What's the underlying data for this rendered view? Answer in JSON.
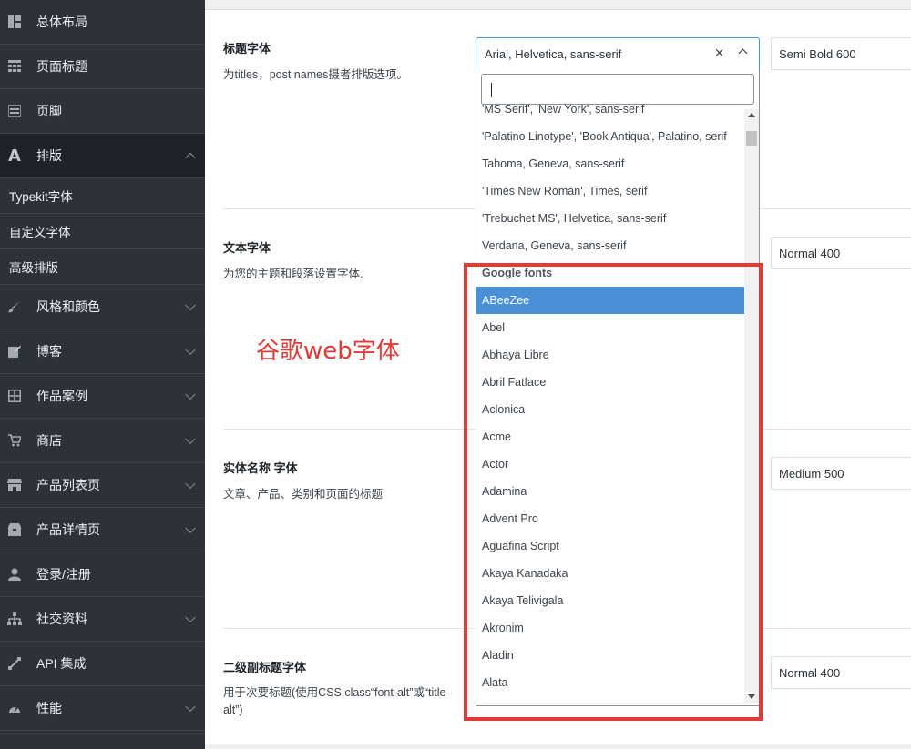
{
  "sidebar": {
    "items": [
      {
        "label": "总体布局",
        "icon": "layout-icon"
      },
      {
        "label": "页面标题",
        "icon": "table-icon"
      },
      {
        "label": "页脚",
        "icon": "footer-icon"
      },
      {
        "label": "排版",
        "icon": "typography-icon",
        "icon_glyph": "A"
      },
      {
        "label": "风格和颜色",
        "icon": "brush-icon"
      },
      {
        "label": "博客",
        "icon": "edit-icon"
      },
      {
        "label": "作品案例",
        "icon": "grid-icon"
      },
      {
        "label": "商店",
        "icon": "cart-icon"
      },
      {
        "label": "产品列表页",
        "icon": "store-icon"
      },
      {
        "label": "产品详情页",
        "icon": "archive-icon"
      },
      {
        "label": "登录/注册",
        "icon": "user-icon"
      },
      {
        "label": "社交资料",
        "icon": "network-icon"
      },
      {
        "label": "API 集成",
        "icon": "plugin-icon"
      },
      {
        "label": "性能",
        "icon": "dashboard-icon"
      }
    ],
    "subitems": [
      {
        "label": "Typekit字体"
      },
      {
        "label": "自定义字体"
      },
      {
        "label": "高级排版"
      }
    ]
  },
  "sections": [
    {
      "title": "标题字体",
      "desc": "为titles，post names摄者排版选项。",
      "weight": "Semi Bold 600"
    },
    {
      "title": "文本字体",
      "desc": "为您的主题和段落设置字体.",
      "weight": "Normal 400"
    },
    {
      "title": "实体名称 字体",
      "desc": "文章、产品、类别和页面的标题",
      "weight": "Medium 500"
    },
    {
      "title": "二级副标题字体",
      "desc": "用于次要标题(使用CSS class“font-alt”或“title-alt”)",
      "weight": "Normal 400"
    }
  ],
  "select": {
    "value": "Arial, Helvetica, sans-serif",
    "clear_symbol": "×"
  },
  "options": [
    "'MS Serif', 'New York', sans-serif",
    "'Palatino Linotype', 'Book Antiqua', Palatino, serif",
    "Tahoma, Geneva, sans-serif",
    "'Times New Roman', Times, serif",
    "'Trebuchet MS', Helvetica, sans-serif",
    "Verdana, Geneva, sans-serif",
    "Google fonts",
    "ABeeZee",
    "Abel",
    "Abhaya Libre",
    "Abril Fatface",
    "Aclonica",
    "Acme",
    "Actor",
    "Adamina",
    "Advent Pro",
    "Aguafina Script",
    "Akaya Kanadaka",
    "Akaya Telivigala",
    "Akronim",
    "Aladin",
    "Alata"
  ],
  "group_label": "Google fonts",
  "selected_option": "ABeeZee",
  "annotation": "谷歌web字体",
  "colors": {
    "sidebar_bg": "#2c3338",
    "selected_option": "#4a90d9",
    "annotation_red": "#e53935"
  }
}
